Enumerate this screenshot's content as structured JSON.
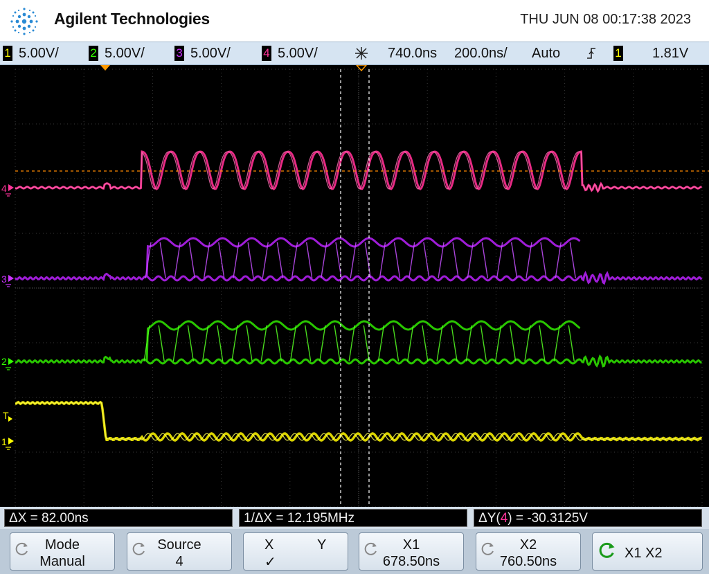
{
  "header": {
    "brand": "Agilent Technologies",
    "datetime": "THU JUN 08 00:17:38 2023"
  },
  "status": {
    "channels": [
      {
        "num": "1",
        "scale": "5.00V/",
        "color": "#ffff00"
      },
      {
        "num": "2",
        "scale": "5.00V/",
        "color": "#33ff00"
      },
      {
        "num": "3",
        "scale": "5.00V/",
        "color": "#cc33ff"
      },
      {
        "num": "4",
        "scale": "5.00V/",
        "color": "#ff3399"
      }
    ],
    "delay": "740.0ns",
    "timebase": "200.0ns/",
    "trigger_mode": "Auto",
    "trigger_source": "1",
    "trigger_level": "1.81V"
  },
  "screen": {
    "ch4_marker": "4",
    "ch3_marker": "3",
    "ch2_marker": "2",
    "ch1_marker": "1",
    "trigger_marker": "T"
  },
  "measurements": {
    "dx": "ΔX = 82.00ns",
    "inv_dx": "1/ΔX = 12.195MHz",
    "dy_prefix": "ΔY(",
    "dy_ch": "4",
    "dy_suffix": ") = -30.3125V"
  },
  "softkeys": {
    "mode": {
      "label": "Mode",
      "value": "Manual"
    },
    "source": {
      "label": "Source",
      "value": "4"
    },
    "xy": {
      "x": "X",
      "y": "Y",
      "check": "✓"
    },
    "x1": {
      "label": "X1",
      "value": "678.50ns"
    },
    "x2": {
      "label": "X2",
      "value": "760.50ns"
    },
    "x1x2": {
      "label": "X1 X2"
    }
  }
}
